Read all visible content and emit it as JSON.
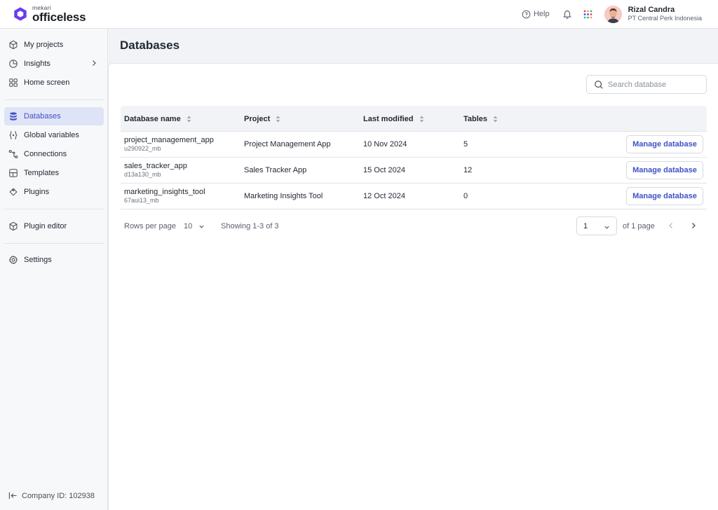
{
  "brand": {
    "small": "mekari",
    "big": "officeless",
    "color": "#6a3bf0"
  },
  "header": {
    "help_label": "Help",
    "user_name": "Rizal Candra",
    "user_company": "PT Central Perk Indonesia"
  },
  "sidebar": {
    "items": [
      {
        "label": "My projects",
        "icon": "cube-icon"
      },
      {
        "label": "Insights",
        "icon": "pie-chart-icon"
      },
      {
        "label": "Home screen",
        "icon": "grid-squares-icon"
      },
      {
        "label": "Databases",
        "icon": "database-icon"
      },
      {
        "label": "Global variables",
        "icon": "braces-icon"
      },
      {
        "label": "Connections",
        "icon": "connections-icon"
      },
      {
        "label": "Templates",
        "icon": "template-icon"
      },
      {
        "label": "Plugins",
        "icon": "puzzle-icon"
      },
      {
        "label": "Plugin editor",
        "icon": "cube-edit-icon"
      },
      {
        "label": "Settings",
        "icon": "gear-icon"
      }
    ],
    "active": "Databases",
    "company_label": "Company ID: 102938"
  },
  "page": {
    "title": "Databases"
  },
  "search": {
    "placeholder": "Search database"
  },
  "table": {
    "columns": [
      "Database name",
      "Project",
      "Last modified",
      "Tables"
    ],
    "rows": [
      {
        "name": "project_management_app",
        "id": "u290922_mb",
        "project": "Project Management App",
        "modified": "10 Nov 2024",
        "tables": "5",
        "action": "Manage database"
      },
      {
        "name": "sales_tracker_app",
        "id": "d13a130_mb",
        "project": "Sales Tracker App",
        "modified": "15 Oct 2024",
        "tables": "12",
        "action": "Manage database"
      },
      {
        "name": "marketing_insights_tool",
        "id": "67aui13_mb",
        "project": "Marketing Insights Tool",
        "modified": "12 Oct 2024",
        "tables": "0",
        "action": "Manage database"
      }
    ]
  },
  "pagination": {
    "rows_per_page_label": "Rows per page",
    "rows_per_page_value": "10",
    "showing": "Showing 1-3 of 3",
    "current_page": "1",
    "of_pages": "of 1 page"
  },
  "colors": {
    "accent": "#3f52c6",
    "active_bg": "#dfe3f6"
  }
}
